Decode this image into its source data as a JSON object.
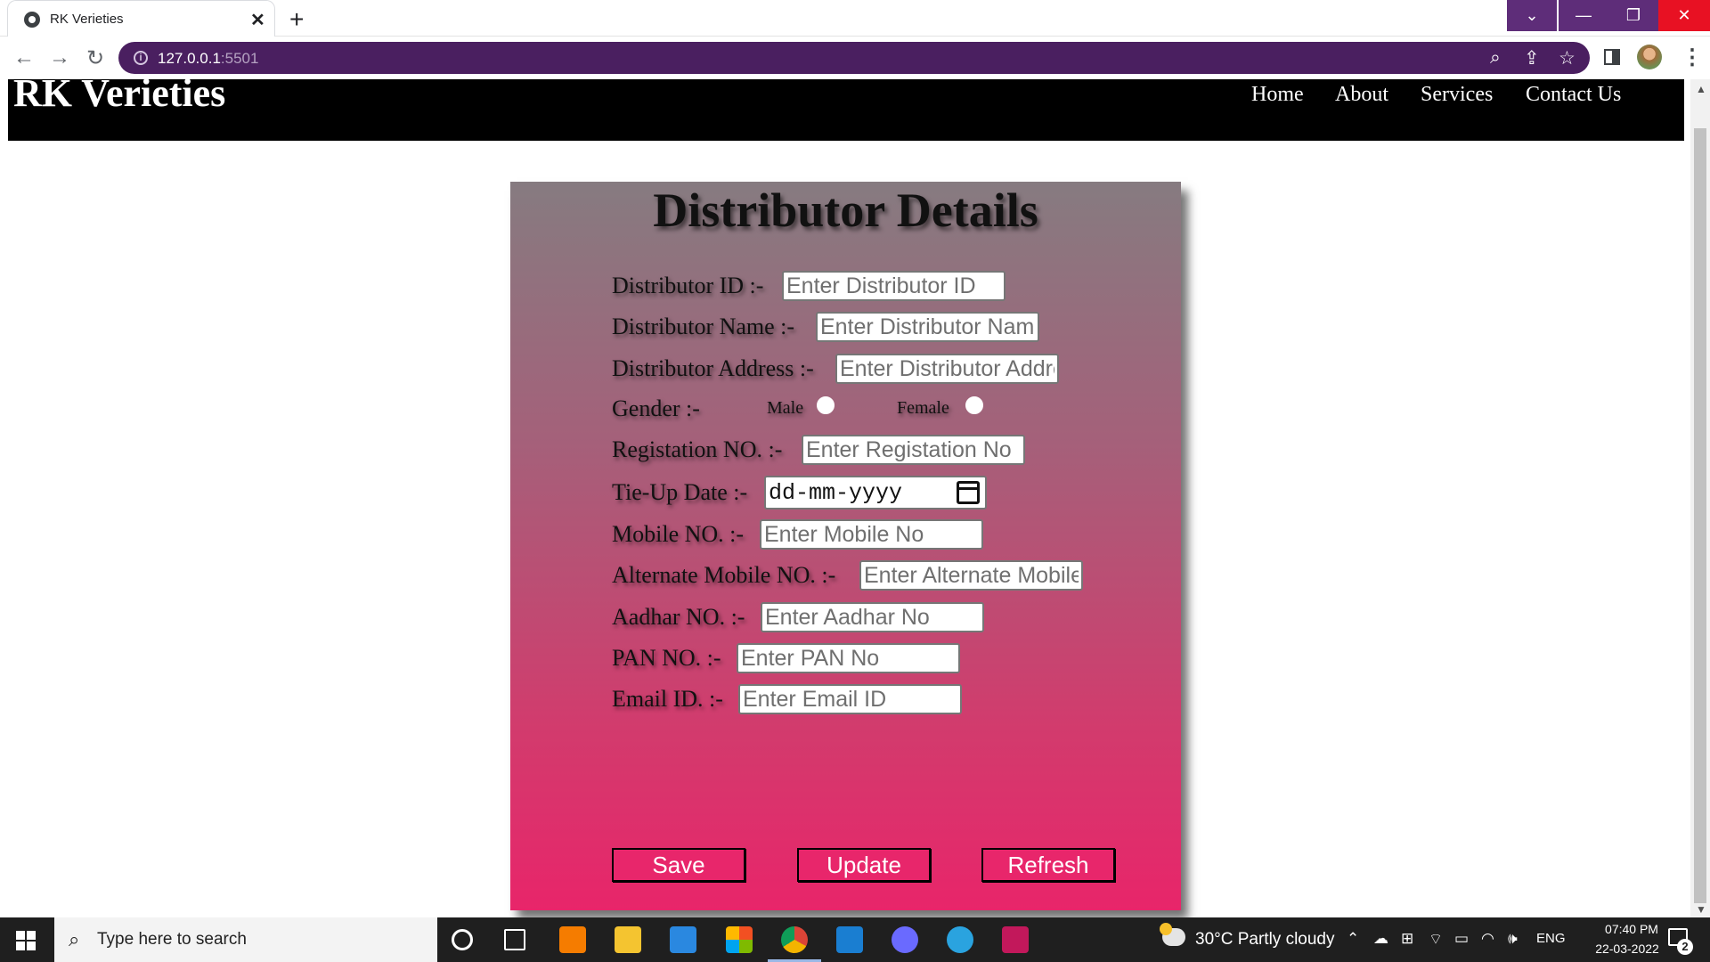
{
  "browser": {
    "tab_title": "RK Verieties",
    "url_host": "127.0.0.1",
    "url_port": ":5501",
    "tab_close": "✕",
    "new_tab": "+",
    "win_chevron": "⌄",
    "win_minimize": "—",
    "win_maximize": "❐",
    "win_close": "✕",
    "back": "←",
    "forward": "→",
    "reload": "↻",
    "info": "i",
    "zoom": "⌕",
    "share": "⇪",
    "star": "☆",
    "menu": "⋮"
  },
  "site": {
    "brand": "RK Verieties",
    "nav": {
      "home": "Home",
      "about": "About",
      "services": "Services",
      "contact": "Contact Us"
    }
  },
  "form": {
    "title": "Distributor Details",
    "fields": [
      {
        "label": "Distributor ID :-",
        "placeholder": "Enter Distributor ID"
      },
      {
        "label": "Distributor Name :-",
        "placeholder": "Enter Distributor Name"
      },
      {
        "label": "Distributor Address :-",
        "placeholder": "Enter Distributor Address"
      },
      {
        "label": "Registation NO. :-",
        "placeholder": "Enter Registation No"
      },
      {
        "label": "Tie-Up Date :-",
        "placeholder": "dd-mm-yyyy"
      },
      {
        "label": "Mobile NO. :-",
        "placeholder": "Enter Mobile No"
      },
      {
        "label": "Alternate Mobile NO. :-",
        "placeholder": "Enter Alternate Mobile No"
      },
      {
        "label": "Aadhar NO. :-",
        "placeholder": "Enter Aadhar No"
      },
      {
        "label": "PAN NO. :-",
        "placeholder": "Enter PAN No"
      },
      {
        "label": "Email ID. :-",
        "placeholder": "Enter Email ID"
      }
    ],
    "gender": {
      "label": "Gender :-",
      "male": "Male",
      "female": "Female"
    },
    "buttons": {
      "save": "Save",
      "update": "Update",
      "refresh": "Refresh"
    }
  },
  "taskbar": {
    "search_placeholder": "Type here to search",
    "search_icon": "⌕",
    "weather": "30°C  Partly cloudy",
    "tray_up": "⌃",
    "tray_cloud": "☁",
    "tray_net": "⊞",
    "tray_wifi": "⌔",
    "tray_batt": "▭",
    "tray_wifi2": "◠",
    "tray_volume": "🕪",
    "language": "ENG",
    "time": "07:40 PM",
    "date": "22-03-2022",
    "notifications": "2"
  },
  "colors": {
    "card_top": "#867b80",
    "card_bottom": "#e8256a",
    "button_bg": "#e8266b",
    "omnibox_bg": "#4a1f60",
    "window_controls": "#5e2d79"
  }
}
